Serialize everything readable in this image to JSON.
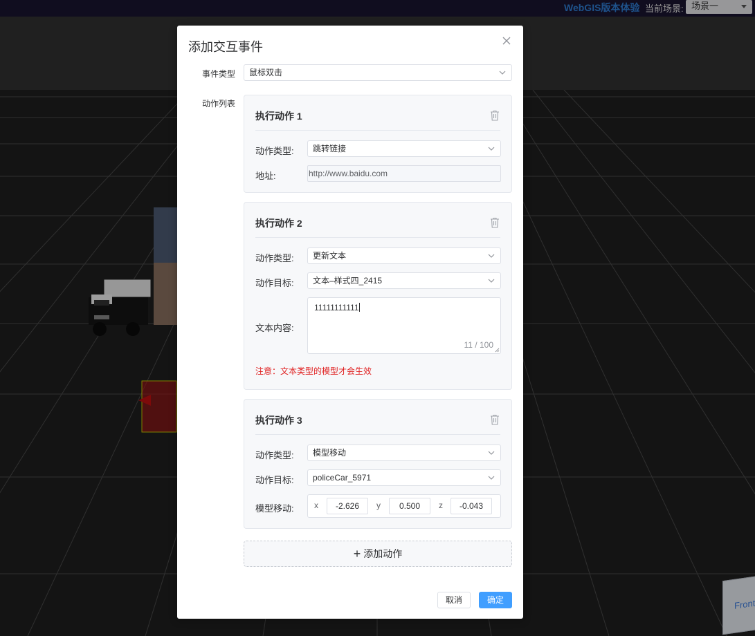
{
  "topbar": {
    "brand": "WebGIS版本体验",
    "scene_label": "当前场景:",
    "scene_value": "场景一"
  },
  "nav_cube": {
    "label": "Front"
  },
  "dialog": {
    "title": "添加交互事件",
    "event_type_label": "事件类型",
    "event_type_value": "鼠标双击",
    "action_list_label": "动作列表",
    "actions": [
      {
        "title": "执行动作 1",
        "type_label": "动作类型:",
        "type_value": "跳转链接",
        "address_label": "地址:",
        "address_value": "http://www.baidu.com"
      },
      {
        "title": "执行动作 2",
        "type_label": "动作类型:",
        "type_value": "更新文本",
        "target_label": "动作目标:",
        "target_value": "文本–样式四_2415",
        "content_label": "文本内容:",
        "content_value": "11111111111",
        "content_count": "11 / 100",
        "warning": "注意：文本类型的模型才会生效"
      },
      {
        "title": "执行动作 3",
        "type_label": "动作类型:",
        "type_value": "模型移动",
        "target_label": "动作目标:",
        "target_value": "policeCar_5971",
        "move_label": "模型移动:",
        "x_label": "x",
        "x_value": "-2.626",
        "y_label": "y",
        "y_value": "0.500",
        "z_label": "z",
        "z_value": "-0.043"
      }
    ],
    "add_action_label": "添加动作",
    "cancel_label": "取消",
    "confirm_label": "确定"
  },
  "colors": {
    "primary": "#409eff",
    "brand": "#2f7fd6",
    "warning": "#e02020"
  }
}
